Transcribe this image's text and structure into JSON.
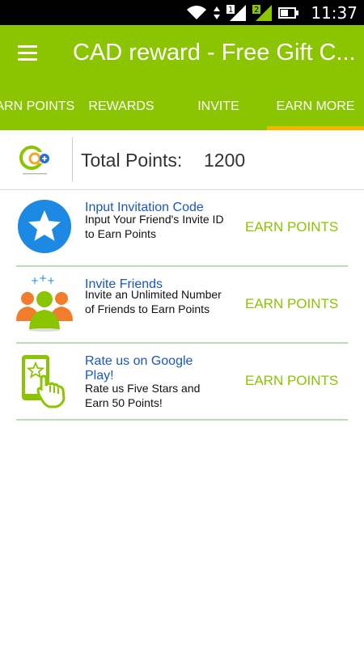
{
  "status_bar": {
    "time": "11:37",
    "sim1": "1",
    "sim2": "2"
  },
  "app_bar": {
    "title": "CAD reward - Free Gift C..."
  },
  "tabs": [
    {
      "label": "EARN POINTS"
    },
    {
      "label": "REWARDS"
    },
    {
      "label": "INVITE"
    },
    {
      "label": "EARN MORE",
      "selected": true
    }
  ],
  "header": {
    "total_label": "Total Points:",
    "total_value": "1200"
  },
  "items": [
    {
      "title": "Input Invitation Code",
      "description": "Input Your Friend's Invite ID to Earn Points",
      "button": "EARN POINTS",
      "icon": "star-icon"
    },
    {
      "title": "Invite Friends",
      "description": "Invite an Unlimited Number of Friends to Earn Points",
      "button": "EARN POINTS",
      "icon": "friends-icon"
    },
    {
      "title": "Rate us on Google Play!",
      "description": "Rate us Five Stars and Earn 50 Points!",
      "button": "EARN POINTS",
      "icon": "phone-rate-icon"
    }
  ],
  "colors": {
    "primary": "#8bc400",
    "accent": "#f5b400",
    "link": "#1a56c4",
    "star_circle": "#1e88e5"
  }
}
